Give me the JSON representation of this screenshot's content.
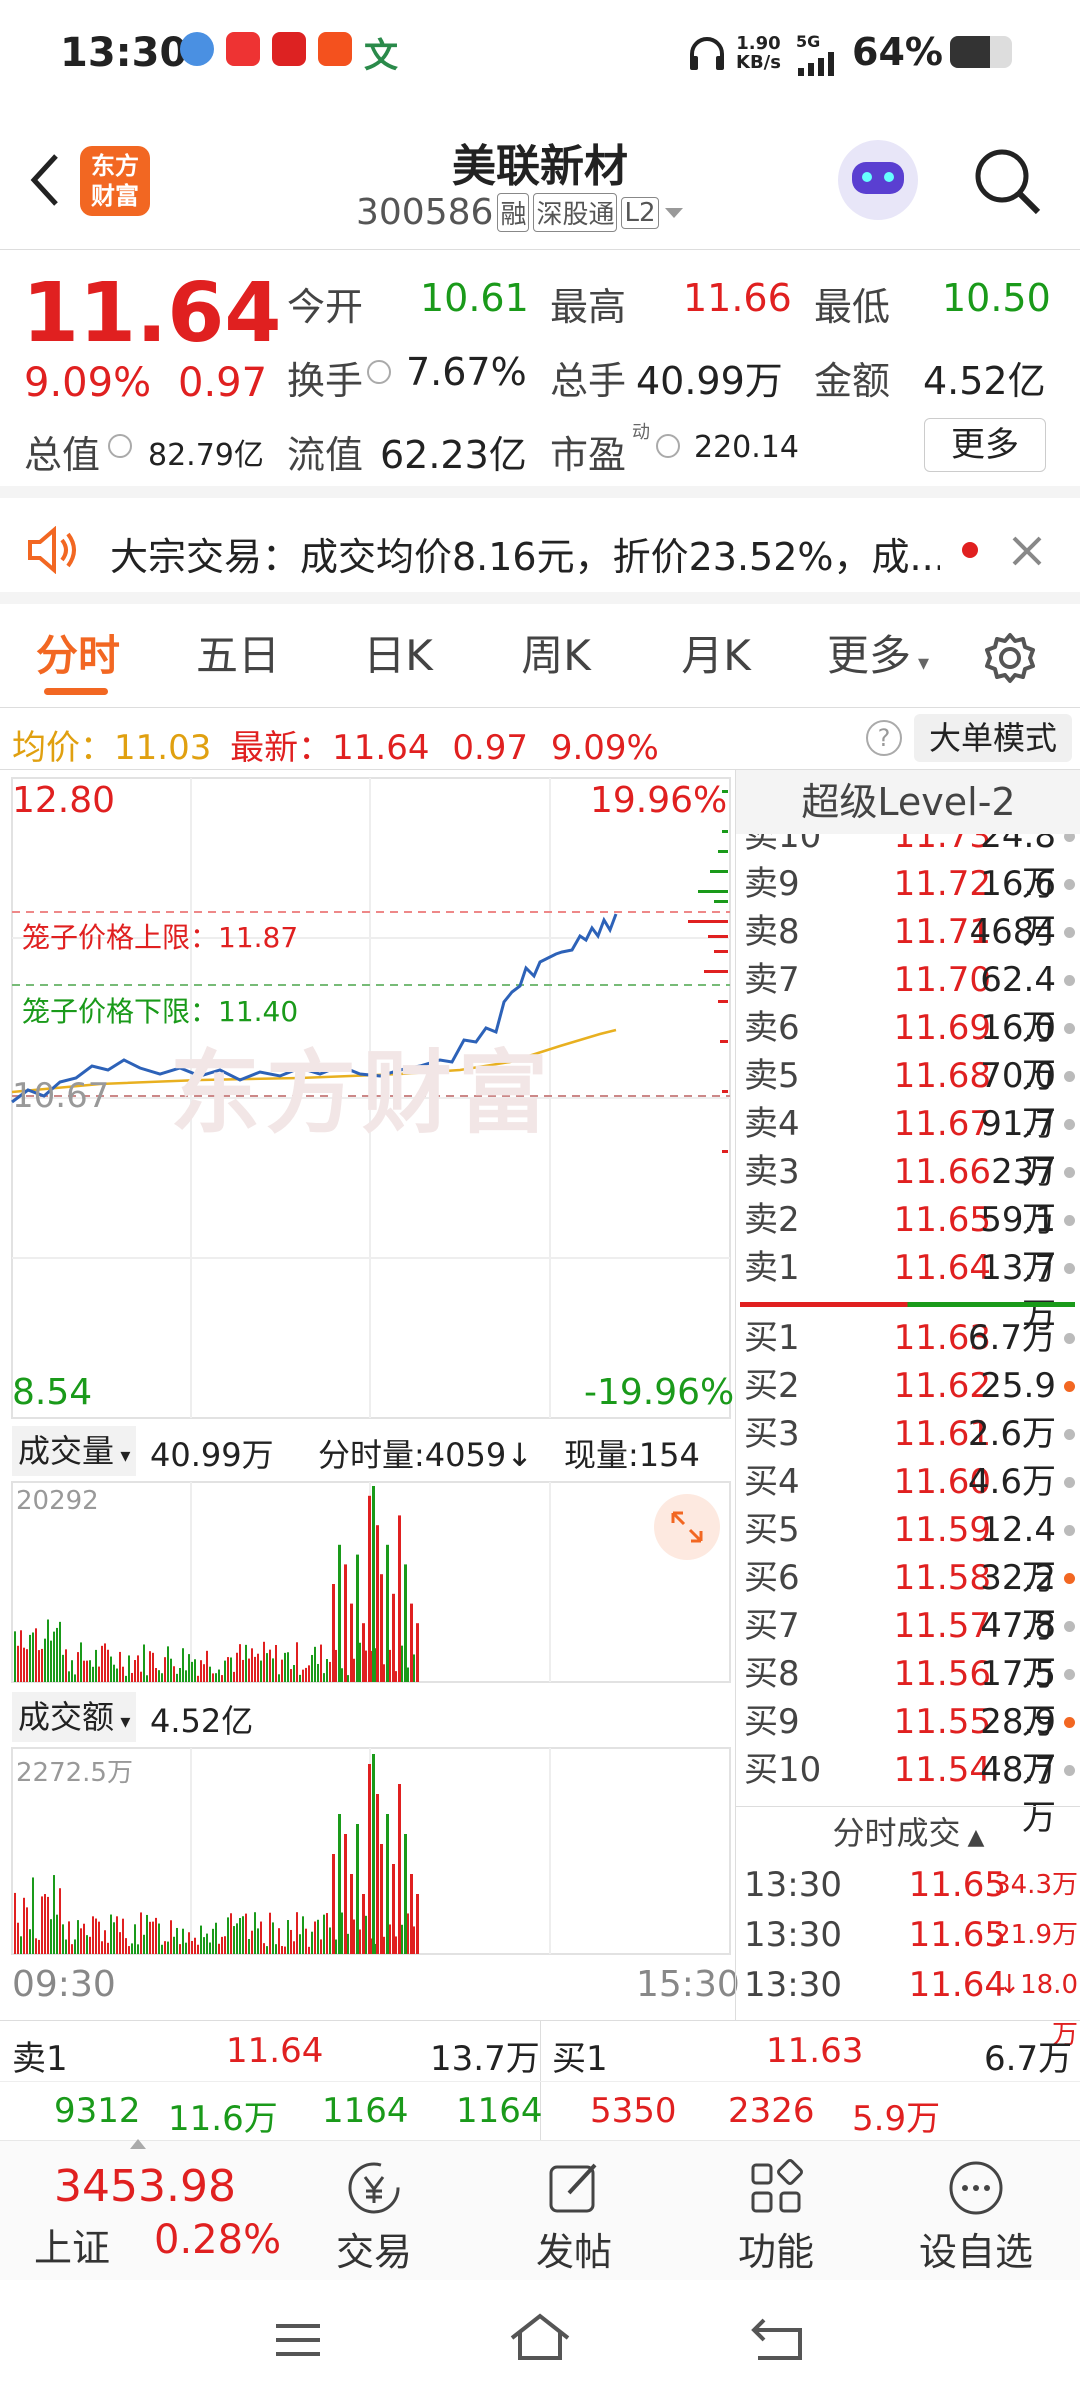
{
  "status": {
    "time": "13:30",
    "speed": "1.90",
    "speed_unit": "KB/s",
    "net": "5G",
    "battery": "64%"
  },
  "header": {
    "logo": "东方财富",
    "logo_line1": "东方",
    "logo_line2": "财富",
    "title": "美联新材",
    "code": "300586",
    "tag_rong": "融",
    "tag_sgt": "深股通",
    "tag_l2": "L2"
  },
  "quote": {
    "price": "11.64",
    "pct": "9.09%",
    "change": "0.97",
    "open_label": "今开",
    "open": "10.61",
    "high_label": "最高",
    "high": "11.66",
    "low_label": "最低",
    "low": "10.50",
    "turnover_label": "换手",
    "turnover": "7.67%",
    "vol_label": "总手",
    "vol": "40.99万",
    "amount_label": "金额",
    "amount": "4.52亿",
    "mcap_label": "总值",
    "mcap": "82.79亿",
    "float_label": "流值",
    "float_cap": "62.23亿",
    "pe_label": "市盈",
    "pe_sup": "动",
    "pe": "220.14",
    "more": "更多"
  },
  "notice": {
    "text": "大宗交易：成交均价8.16元，折价23.52%，成..."
  },
  "tabs": [
    "分时",
    "五日",
    "日K",
    "周K",
    "月K",
    "更多"
  ],
  "infobar": {
    "avg_label": "均价：",
    "avg": "11.03",
    "last_label": "最新：",
    "last": "11.64",
    "chg": "0.97",
    "pct": "9.09%",
    "mode": "大单模式"
  },
  "chart": {
    "y_top": "12.80",
    "pct_top": "19.96%",
    "y_bottom": "8.54",
    "pct_bottom": "-19.96%",
    "prev_close": "10.67",
    "cage_upper": "笼子价格上限：11.87",
    "cage_lower": "笼子价格下限：11.40",
    "vol_label": "成交量",
    "vol_total": "40.99万",
    "split_vol": "分时量:4059↓",
    "cur_vol": "现量:154",
    "vol_max": "20292",
    "amt_label": "成交额",
    "amt_total": "4.52亿",
    "amt_max": "2272.5万",
    "t_start": "09:30",
    "t_end": "15:30",
    "watermark": "东方财富"
  },
  "level2": {
    "title": "超级Level-2",
    "asks": [
      {
        "s": "卖10",
        "p": "11.73",
        "v": "24.8万"
      },
      {
        "s": "卖9",
        "p": "11.72",
        "v": "16.6万"
      },
      {
        "s": "卖8",
        "p": "11.71",
        "v": "4684"
      },
      {
        "s": "卖7",
        "p": "11.70",
        "v": "62.4万"
      },
      {
        "s": "卖6",
        "p": "11.69",
        "v": "16.0万"
      },
      {
        "s": "卖5",
        "p": "11.68",
        "v": "70.0万"
      },
      {
        "s": "卖4",
        "p": "11.67",
        "v": "91.7万"
      },
      {
        "s": "卖3",
        "p": "11.66",
        "v": "237万"
      },
      {
        "s": "卖2",
        "p": "11.65",
        "v": "59.1万"
      },
      {
        "s": "卖1",
        "p": "11.64",
        "v": "13.7万"
      }
    ],
    "bids": [
      {
        "s": "买1",
        "p": "11.63",
        "v": "6.7万"
      },
      {
        "s": "买2",
        "p": "11.62",
        "v": "25.9万"
      },
      {
        "s": "买3",
        "p": "11.61",
        "v": "2.6万"
      },
      {
        "s": "买4",
        "p": "11.60",
        "v": "4.6万"
      },
      {
        "s": "买5",
        "p": "11.59",
        "v": "12.4万"
      },
      {
        "s": "买6",
        "p": "11.58",
        "v": "32.2万"
      },
      {
        "s": "买7",
        "p": "11.57",
        "v": "47.8万"
      },
      {
        "s": "买8",
        "p": "11.56",
        "v": "17.5万"
      },
      {
        "s": "买9",
        "p": "11.55",
        "v": "28.9万"
      },
      {
        "s": "买10",
        "p": "11.54",
        "v": "48.7万"
      }
    ],
    "trades_title": "分时成交",
    "trades": [
      {
        "t": "13:30",
        "p": "11.65",
        "v": "34.3万"
      },
      {
        "t": "13:30",
        "p": "11.65",
        "v": "21.9万"
      },
      {
        "t": "13:30",
        "p": "11.64",
        "v": "↓18.0万"
      }
    ]
  },
  "bottom": {
    "sell_label": "卖1",
    "sell_price": "11.64",
    "sell_vol": "13.7万",
    "buy_label": "买1",
    "buy_price": "11.63",
    "buy_vol": "6.7万",
    "row2": [
      "9312",
      "11.6万",
      "1164",
      "1164",
      "5350",
      "2326",
      "5.9万"
    ]
  },
  "tabbar": {
    "index_value": "3453.98",
    "index_name": "上证",
    "index_pct": "0.28%",
    "trade": "交易",
    "post": "发帖",
    "func": "功能",
    "watch": "设自选"
  }
}
